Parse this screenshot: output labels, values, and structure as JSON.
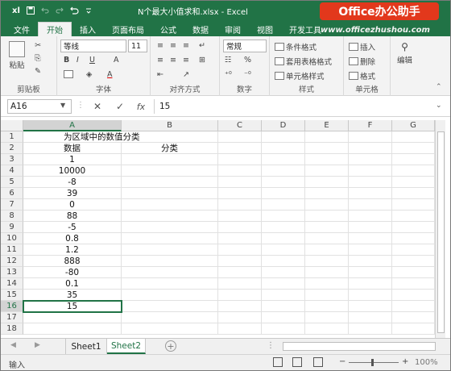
{
  "titlebar": {
    "app_icon": "xl",
    "save_icon": "save-icon",
    "title": "N个最大小值求和.xlsx - Excel"
  },
  "watermark": {
    "brand": "Office办公助手",
    "url": "www.officezhushou.com"
  },
  "tabs": [
    {
      "label": "文件"
    },
    {
      "label": "开始",
      "active": true
    },
    {
      "label": "插入"
    },
    {
      "label": "页面布局"
    },
    {
      "label": "公式"
    },
    {
      "label": "数据"
    },
    {
      "label": "审阅"
    },
    {
      "label": "视图"
    },
    {
      "label": "开发工具"
    }
  ],
  "ribbon": {
    "paste_label": "粘贴",
    "font_name": "等线",
    "font_size": "11",
    "number_format": "常规",
    "percent": "%",
    "bold": "B",
    "italic": "I",
    "underline": "U",
    "grow_font": "A",
    "fill_a": "A",
    "conditional": "条件格式",
    "table_format": "套用表格格式",
    "cell_style": "单元格样式",
    "insert": "插入",
    "delete": "删除",
    "format": "格式",
    "edit": "编辑",
    "groups": {
      "clipboard": "剪贴板",
      "font": "字体",
      "align": "对齐方式",
      "number": "数字",
      "style": "样式",
      "cells": "单元格"
    }
  },
  "formula_bar": {
    "name_box": "A16",
    "cancel": "✕",
    "confirm": "✓",
    "fx": "fx",
    "formula": "15"
  },
  "columns": [
    "A",
    "B",
    "C",
    "D",
    "E",
    "F",
    "G"
  ],
  "rows": [
    {
      "num": "1",
      "a": "为区域中的数值分类",
      "b": ""
    },
    {
      "num": "2",
      "a": "数据",
      "b": "分类"
    },
    {
      "num": "3",
      "a": "1",
      "b": ""
    },
    {
      "num": "4",
      "a": "10000",
      "b": ""
    },
    {
      "num": "5",
      "a": "-8",
      "b": ""
    },
    {
      "num": "6",
      "a": "39",
      "b": ""
    },
    {
      "num": "7",
      "a": "0",
      "b": ""
    },
    {
      "num": "8",
      "a": "88",
      "b": ""
    },
    {
      "num": "9",
      "a": "-5",
      "b": ""
    },
    {
      "num": "10",
      "a": "0.8",
      "b": ""
    },
    {
      "num": "11",
      "a": "1.2",
      "b": ""
    },
    {
      "num": "12",
      "a": "888",
      "b": ""
    },
    {
      "num": "13",
      "a": "-80",
      "b": ""
    },
    {
      "num": "14",
      "a": "0.1",
      "b": ""
    },
    {
      "num": "15",
      "a": "35",
      "b": ""
    },
    {
      "num": "16",
      "a": "15",
      "b": ""
    },
    {
      "num": "17",
      "a": "",
      "b": ""
    },
    {
      "num": "18",
      "a": "",
      "b": ""
    }
  ],
  "sheets": [
    {
      "label": "Sheet1"
    },
    {
      "label": "Sheet2",
      "active": true
    }
  ],
  "status": {
    "mode": "输入",
    "zoom": "100%"
  }
}
